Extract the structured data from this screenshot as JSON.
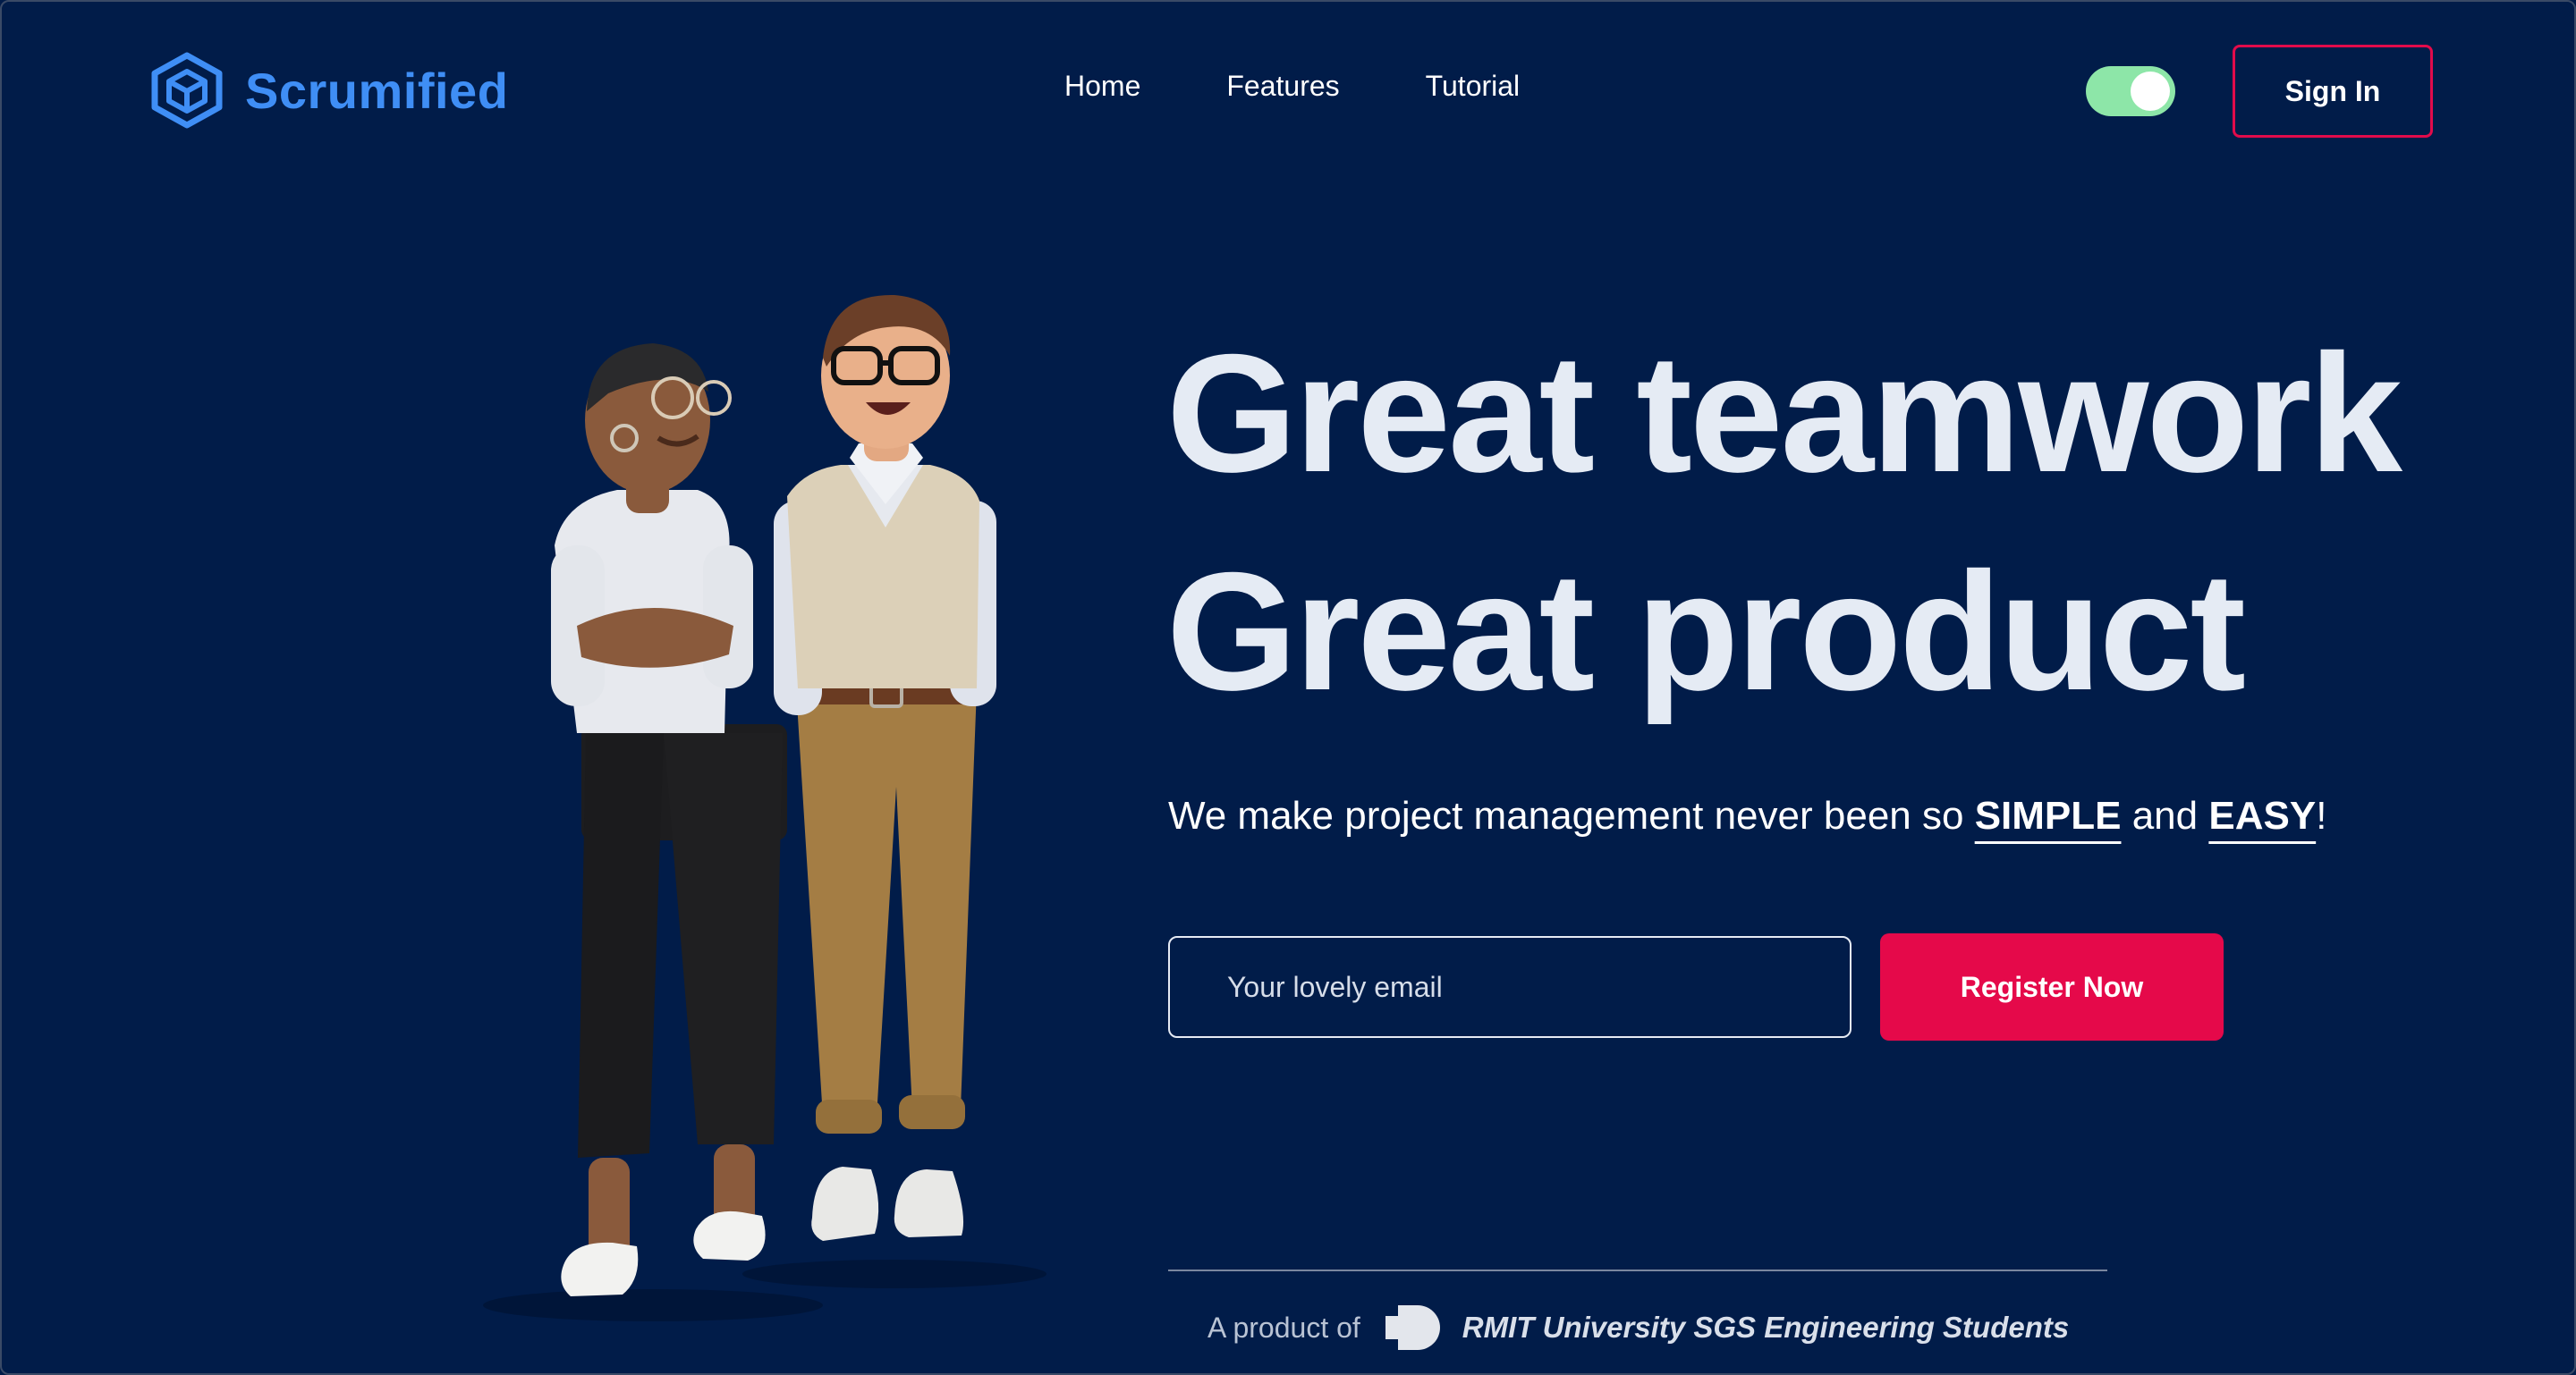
{
  "header": {
    "brand": "Scrumified",
    "logo_icon": "hexagon-cube-icon",
    "nav": [
      "Home",
      "Features",
      "Tutorial"
    ],
    "theme_toggle": {
      "state": "on",
      "color": "#8de6a8"
    },
    "signin_label": "Sign In"
  },
  "hero": {
    "headline_line1": "Great teamwork",
    "headline_line2": "Great product",
    "tagline_prefix": "We make project management never been so ",
    "tagline_word1": "SIMPLE",
    "tagline_mid": " and ",
    "tagline_word2": "EASY",
    "tagline_suffix": "!",
    "email_placeholder": "Your lovely email",
    "register_label": "Register Now",
    "illustration": "two-people-standing-illustration"
  },
  "footer": {
    "product_of": "A product of",
    "org_logo": "rmit-logo-icon",
    "org_name": "RMIT University SGS Engineering Students"
  },
  "colors": {
    "background": "#011c49",
    "brand": "#3f8ef5",
    "accent": "#e5094a",
    "headline": "#e5ebf4"
  }
}
